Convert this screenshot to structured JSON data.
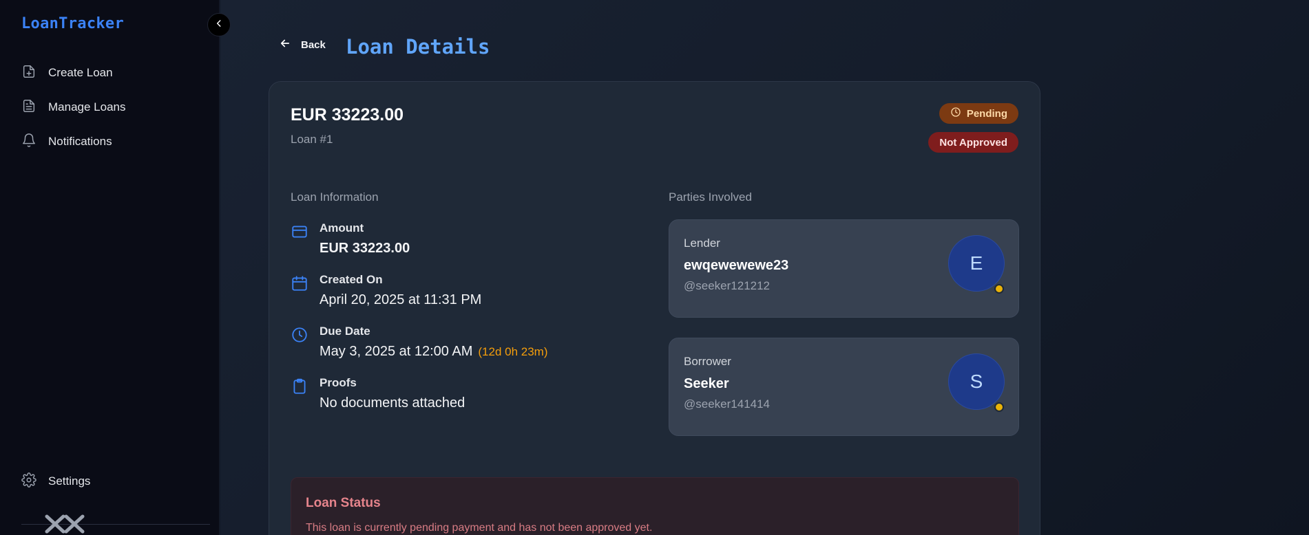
{
  "sidebar": {
    "brand": "LoanTracker",
    "items": [
      {
        "label": "Create Loan",
        "icon": "file-plus-icon"
      },
      {
        "label": "Manage Loans",
        "icon": "file-text-icon"
      },
      {
        "label": "Notifications",
        "icon": "bell-icon"
      }
    ],
    "settings_label": "Settings"
  },
  "header": {
    "back_label": "Back",
    "title": "Loan Details"
  },
  "loan": {
    "amount_title": "EUR 33223.00",
    "loan_number": "Loan #1",
    "status_badge": "Pending",
    "approval_badge": "Not Approved",
    "colors": {
      "pending": "#7c3a12",
      "not_approved": "#7f1d1d",
      "accent": "#60a5fa",
      "countdown": "#f59e0b"
    }
  },
  "info": {
    "section_title": "Loan Information",
    "amount_label": "Amount",
    "amount_value": "EUR 33223.00",
    "created_label": "Created On",
    "created_value": "April 20, 2025 at 11:31 PM",
    "due_label": "Due Date",
    "due_value": "May 3, 2025 at 12:00 AM",
    "due_countdown": "(12d 0h 23m)",
    "proofs_label": "Proofs",
    "proofs_value": "No documents attached"
  },
  "parties": {
    "section_title": "Parties Involved",
    "lender": {
      "role": "Lender",
      "name": "ewqewewewe23",
      "handle": "@seeker121212",
      "initial": "E"
    },
    "borrower": {
      "role": "Borrower",
      "name": "Seeker",
      "handle": "@seeker141414",
      "initial": "S"
    }
  },
  "status": {
    "title": "Loan Status",
    "text": "This loan is currently pending payment and has not been approved yet."
  }
}
